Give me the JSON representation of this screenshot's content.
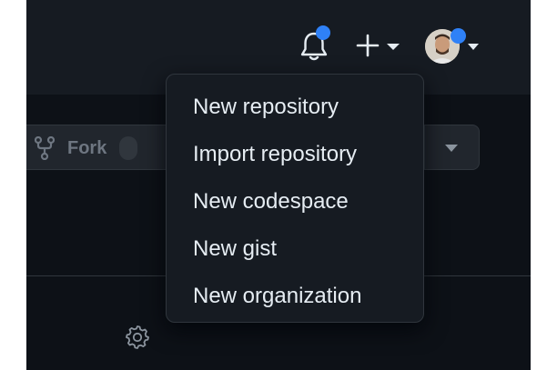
{
  "header": {
    "notifications_icon": "bell-icon",
    "create_icon": "plus-icon",
    "avatar_icon": "avatar",
    "badge_color": "#2f81f7"
  },
  "repo_actions": {
    "fork_label": "Fork",
    "fork_icon": "fork-icon"
  },
  "create_menu": {
    "items": [
      {
        "label": "New repository"
      },
      {
        "label": "Import repository"
      },
      {
        "label": "New codespace"
      },
      {
        "label": "New gist"
      },
      {
        "label": "New organization"
      }
    ]
  },
  "colors": {
    "background": "#0d1117",
    "header": "#161b22",
    "menu": "#161b22",
    "border": "#30363d",
    "text": "#e6edf3",
    "accent": "#2f81f7"
  }
}
